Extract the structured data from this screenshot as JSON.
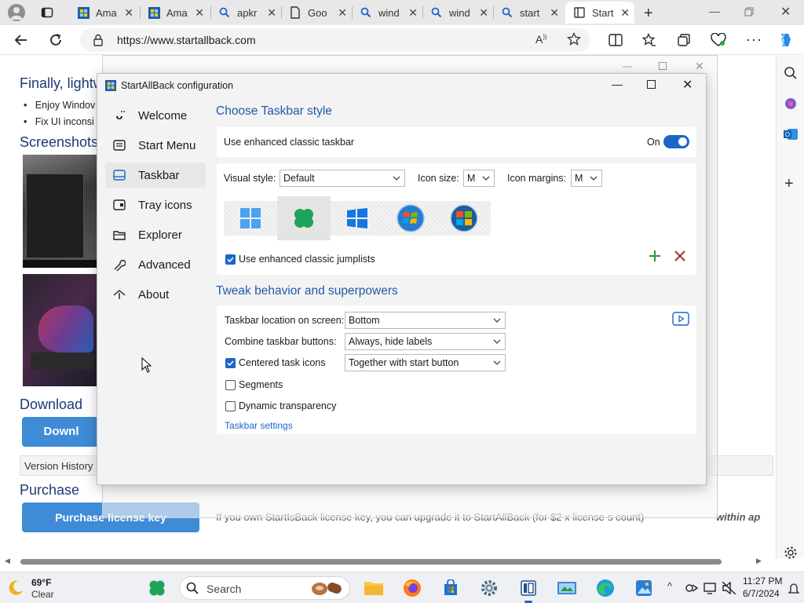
{
  "browser": {
    "tabs": [
      {
        "label": "Ama",
        "icon": "windows-grid-icon"
      },
      {
        "label": "Ama",
        "icon": "windows-grid-icon"
      },
      {
        "label": "apkr",
        "icon": "search-icon"
      },
      {
        "label": "Goo",
        "icon": "document-icon"
      },
      {
        "label": "wind",
        "icon": "search-icon"
      },
      {
        "label": "wind",
        "icon": "search-icon"
      },
      {
        "label": "start",
        "icon": "search-icon"
      },
      {
        "label": "Start",
        "icon": "page-icon"
      }
    ],
    "url": "https://www.startallback.com"
  },
  "page": {
    "heading": "Finally, lightw",
    "bullets": [
      "Enjoy Windov",
      "Fix UI inconsi"
    ],
    "screenshots": "Screenshots",
    "download": "Download",
    "download_button": "Downl",
    "version_history": "Version History",
    "purchase": "Purchase",
    "purchase_button": "Purchase license key",
    "footer_text": "If you own StartIsBack license key, you can upgrade it to StartAllBack (for $2 x license-s count)",
    "footer_emph": "within ap"
  },
  "dialog": {
    "title": "StartAllBack configuration",
    "nav": [
      {
        "label": "Welcome",
        "icon": "smiley-icon"
      },
      {
        "label": "Start Menu",
        "icon": "start-menu-icon"
      },
      {
        "label": "Taskbar",
        "icon": "taskbar-icon"
      },
      {
        "label": "Tray icons",
        "icon": "tray-icon"
      },
      {
        "label": "Explorer",
        "icon": "folder-icon"
      },
      {
        "label": "Advanced",
        "icon": "wrench-icon"
      },
      {
        "label": "About",
        "icon": "info-icon"
      }
    ],
    "section1": "Choose Taskbar style",
    "enhanced_label": "Use enhanced classic taskbar",
    "toggle_text": "On",
    "visual_style_label": "Visual style:",
    "visual_style_value": "Default",
    "icon_size_label": "Icon size:",
    "icon_size_value": "M",
    "icon_margins_label": "Icon margins:",
    "icon_margins_value": "M",
    "jumplists_label": "Use enhanced classic jumplists",
    "section2": "Tweak behavior and superpowers",
    "location_label": "Taskbar location on screen:",
    "location_value": "Bottom",
    "combine_label": "Combine taskbar buttons:",
    "combine_value": "Always, hide labels",
    "centered_label": "Centered task icons",
    "centered_value": "Together with start button",
    "segments_label": "Segments",
    "dynamic_label": "Dynamic transparency",
    "settings_link": "Taskbar settings"
  },
  "taskbar": {
    "temperature": "69°F",
    "weather": "Clear",
    "search_placeholder": "Search",
    "time": "11:27 PM",
    "date": "6/7/2024"
  },
  "colors": {
    "accent": "#1a67c6",
    "heading_blue": "#1f5aa8",
    "page_button": "#3f8bd6"
  }
}
